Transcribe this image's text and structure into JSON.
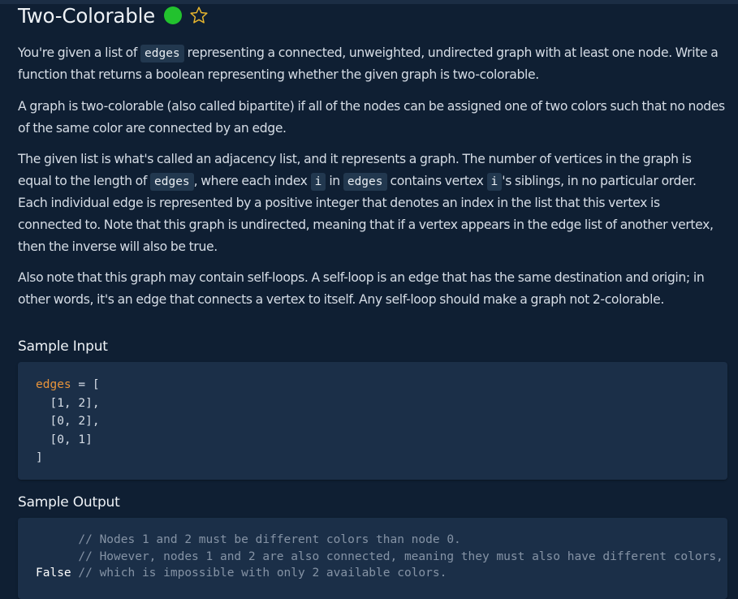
{
  "problem": {
    "title": "Two-Colorable",
    "status_icon": "solved-check-dot",
    "favorite_icon": "star-outline-icon",
    "accent_colors": {
      "status": "#22c22e",
      "star": "#e6b52e",
      "code_key": "#e8943a"
    }
  },
  "description": {
    "p1": {
      "t1": "You're given a list of",
      "c1": "edges",
      "t2": "representing a connected, unweighted, undirected graph with at least one node. Write a function that returns a boolean representing whether the given graph is two-colorable."
    },
    "p2": "A graph is two-colorable (also called bipartite) if all of the nodes can be assigned one of two colors such that no nodes of the same color are connected by an edge.",
    "p3": {
      "t1": "The given list is what's called an adjacency list, and it represents a graph. The number of vertices in the graph is equal to the length of",
      "c1": "edges",
      "t2": ", where each index",
      "c2": "i",
      "t3": "in",
      "c3": "edges",
      "t4": "contains vertex",
      "c4": "i",
      "t5": "'s siblings, in no particular order. Each individual edge is represented by a positive integer that denotes an index in the list that this vertex is connected to. Note that this graph is undirected, meaning that if a vertex appears in the edge list of another vertex, then the inverse will also be true."
    },
    "p4": "Also note that this graph may contain self-loops. A self-loop is an edge that has the same destination and origin; in other words, it's an edge that connects a vertex to itself. Any self-loop should make a graph not 2-colorable."
  },
  "sample_input": {
    "heading": "Sample Input",
    "var_name": "edges",
    "assign": " = [",
    "rows": [
      "  [1, 2],",
      "  [0, 2],",
      "  [0, 1]"
    ],
    "close": "]"
  },
  "sample_output": {
    "heading": "Sample Output",
    "comments": [
      "      // Nodes 1 and 2 must be different colors than node 0.",
      "      // However, nodes 1 and 2 are also connected, meaning they must also have different colors,",
      " // which is impossible with only 2 available colors."
    ],
    "value": "False"
  }
}
